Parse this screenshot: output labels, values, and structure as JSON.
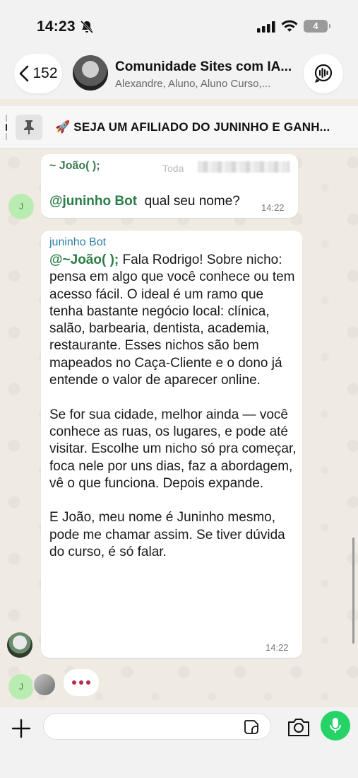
{
  "status_bar": {
    "time": "14:23",
    "battery": "4"
  },
  "header": {
    "back_count": "152",
    "title": "Comunidade Sites com IA...",
    "members": "Alexandre, Aluno, Aluno Curso,..."
  },
  "pinned": {
    "text": "🚀 SEJA UM AFILIADO DO JUNINHO E GANH..."
  },
  "messages": [
    {
      "quote_author": "~ João( );",
      "quote_text": "Toda",
      "mention": "@juninho Bot",
      "text": "qual seu nome?",
      "time": "14:22",
      "avatar_initial": "J"
    },
    {
      "sender": "juninho Bot",
      "mention": "@~João( );",
      "paragraph_1": "Fala Rodrigo! Sobre nicho: pensa em algo que você conhece ou tem acesso fácil. O ideal é um ramo que tenha bastante negócio local: clínica, salão, barbearia, dentista, academia, restaurante. Esses nichos são bem mapeados no Caça-Cliente e o dono já entende o valor de aparecer online.",
      "paragraph_2": "Se for sua cidade, melhor ainda — você conhece as ruas, os lugares, e pode até visitar. Escolhe um nicho só pra começar, foca nele por uns dias, faz a abordagem, vê o que funciona. Depois expande.",
      "paragraph_3": "E João, meu nome é Juninho mesmo, pode me chamar assim. Se tiver dúvida do curso, é só falar.",
      "time": "14:22"
    }
  ],
  "typing": {
    "avatar_initial": "J"
  },
  "input": {
    "placeholder": "",
    "value": ""
  },
  "colors": {
    "accent_green": "#25d366",
    "mention_green": "#2a7d46",
    "sender_blue": "#2f7ea6",
    "typing_dots": "#b52d4a"
  },
  "icons": [
    "bell-slash-icon",
    "signal-icon",
    "wifi-icon",
    "chevron-left-icon",
    "voice-chat-icon",
    "pin-icon",
    "plus-icon",
    "sticker-icon",
    "camera-icon",
    "microphone-icon"
  ]
}
